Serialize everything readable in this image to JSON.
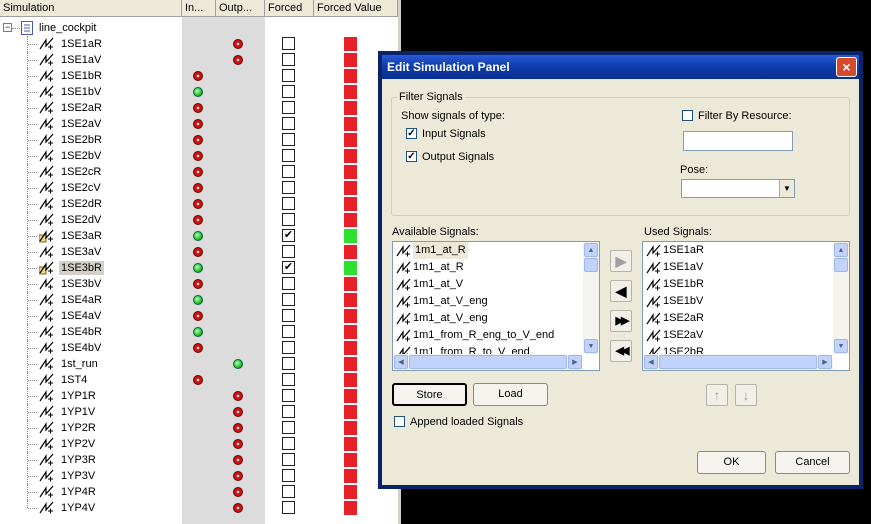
{
  "table": {
    "headers": {
      "simulation": "Simulation",
      "input": "In...",
      "output": "Outp...",
      "forced": "Forced",
      "forced_value": "Forced Value"
    },
    "root": {
      "expander": "−",
      "label": "line_cockpit"
    },
    "rows": [
      {
        "label": "1SE1aR",
        "input": "",
        "output": "red",
        "forced": false,
        "value": "red"
      },
      {
        "label": "1SE1aV",
        "input": "",
        "output": "red",
        "forced": false,
        "value": "red"
      },
      {
        "label": "1SE1bR",
        "input": "red",
        "output": "",
        "forced": false,
        "value": "red"
      },
      {
        "label": "1SE1bV",
        "input": "green",
        "output": "",
        "forced": false,
        "value": "red"
      },
      {
        "label": "1SE2aR",
        "input": "red",
        "output": "",
        "forced": false,
        "value": "red"
      },
      {
        "label": "1SE2aV",
        "input": "red",
        "output": "",
        "forced": false,
        "value": "red"
      },
      {
        "label": "1SE2bR",
        "input": "red",
        "output": "",
        "forced": false,
        "value": "red"
      },
      {
        "label": "1SE2bV",
        "input": "red",
        "output": "",
        "forced": false,
        "value": "red"
      },
      {
        "label": "1SE2cR",
        "input": "red",
        "output": "",
        "forced": false,
        "value": "red"
      },
      {
        "label": "1SE2cV",
        "input": "red",
        "output": "",
        "forced": false,
        "value": "red"
      },
      {
        "label": "1SE2dR",
        "input": "red",
        "output": "",
        "forced": false,
        "value": "red"
      },
      {
        "label": "1SE2dV",
        "input": "red",
        "output": "",
        "forced": false,
        "value": "red"
      },
      {
        "label": "1SE3aR",
        "input": "green",
        "output": "",
        "forced": true,
        "value": "green",
        "locked": true
      },
      {
        "label": "1SE3aV",
        "input": "red",
        "output": "",
        "forced": false,
        "value": "red"
      },
      {
        "label": "1SE3bR",
        "input": "green",
        "output": "",
        "forced": true,
        "value": "green",
        "locked": true,
        "selected": true
      },
      {
        "label": "1SE3bV",
        "input": "red",
        "output": "",
        "forced": false,
        "value": "red"
      },
      {
        "label": "1SE4aR",
        "input": "green",
        "output": "",
        "forced": false,
        "value": "red"
      },
      {
        "label": "1SE4aV",
        "input": "red",
        "output": "",
        "forced": false,
        "value": "red"
      },
      {
        "label": "1SE4bR",
        "input": "green",
        "output": "",
        "forced": false,
        "value": "red"
      },
      {
        "label": "1SE4bV",
        "input": "red",
        "output": "",
        "forced": false,
        "value": "red"
      },
      {
        "label": "1st_run",
        "input": "",
        "output": "green",
        "forced": false,
        "value": "red"
      },
      {
        "label": "1ST4",
        "input": "red",
        "output": "",
        "forced": false,
        "value": "red"
      },
      {
        "label": "1YP1R",
        "input": "",
        "output": "red",
        "forced": false,
        "value": "red"
      },
      {
        "label": "1YP1V",
        "input": "",
        "output": "red",
        "forced": false,
        "value": "red"
      },
      {
        "label": "1YP2R",
        "input": "",
        "output": "red",
        "forced": false,
        "value": "red"
      },
      {
        "label": "1YP2V",
        "input": "",
        "output": "red",
        "forced": false,
        "value": "red"
      },
      {
        "label": "1YP3R",
        "input": "",
        "output": "red",
        "forced": false,
        "value": "red"
      },
      {
        "label": "1YP3V",
        "input": "",
        "output": "red",
        "forced": false,
        "value": "red"
      },
      {
        "label": "1YP4R",
        "input": "",
        "output": "red",
        "forced": false,
        "value": "red"
      },
      {
        "label": "1YP4V",
        "input": "",
        "output": "red",
        "forced": false,
        "value": "red"
      }
    ]
  },
  "dialog": {
    "title": "Edit Simulation Panel",
    "close": "×",
    "filter": {
      "legend": "Filter Signals",
      "show_label": "Show signals of type:",
      "input_signals": {
        "label": "Input Signals",
        "checked": true
      },
      "output_signals": {
        "label": "Output Signals",
        "checked": true
      },
      "filter_by_resource": {
        "label": "Filter By Resource:",
        "checked": false,
        "value": ""
      },
      "pose": {
        "label": "Pose:",
        "value": ""
      }
    },
    "available": {
      "label": "Available Signals:",
      "items": [
        "1m1_at_R",
        "1m1_at_R",
        "1m1_at_V",
        "1m1_at_V_eng",
        "1m1_at_V_eng",
        "1m1_from_R_eng_to_V_end",
        "1m1_from_R_to_V_end"
      ]
    },
    "used": {
      "label": "Used Signals:",
      "items": [
        "1SE1aR",
        "1SE1aV",
        "1SE1bR",
        "1SE1bV",
        "1SE2aR",
        "1SE2aV",
        "1SE2bR"
      ]
    },
    "arrows": {
      "add": "▶",
      "remove": "◀",
      "add_all": "▶▶",
      "remove_all": "◀◀",
      "up": "↑",
      "down": "↓"
    },
    "store": "Store",
    "load": "Load",
    "append": {
      "label": "Append loaded Signals",
      "checked": false
    },
    "ok": "OK",
    "cancel": "Cancel"
  },
  "colors": {
    "red": "#e8202a",
    "green": "#30e030",
    "titlebar": "#0a3ba8"
  }
}
